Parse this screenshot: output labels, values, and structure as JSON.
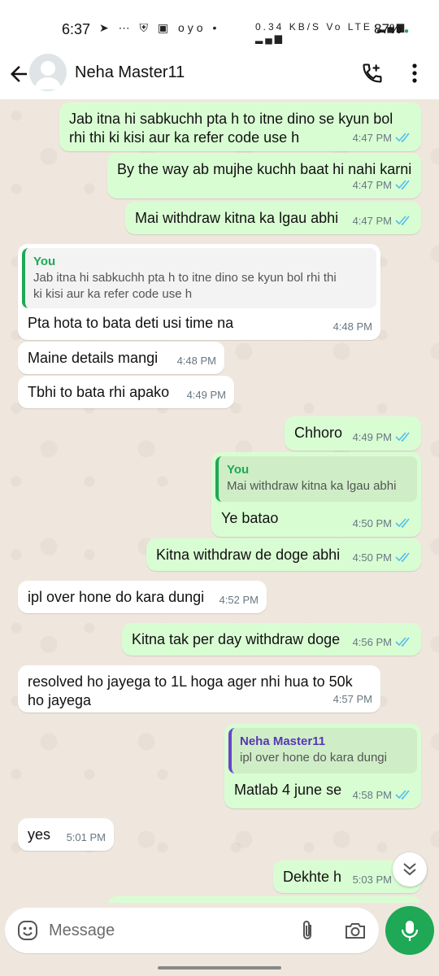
{
  "status_bar": {
    "time": "6:37",
    "left_icons": "➤ ⋯ ⛨ ▣ oyo •",
    "network_speed": "0.34 KB/S",
    "right_icons": "Vo LTE ▂▄▆ ▂▄▆",
    "battery": "87%"
  },
  "header": {
    "contact_name": "Neha Master11"
  },
  "messages": [
    {
      "dir": "out",
      "text_lines": [
        "Jab itna hi sabkuchh pta h to itne dino se kyun bol",
        "rhi thi ki kisi aur ka refer code use h"
      ],
      "time": "4:47 PM"
    },
    {
      "dir": "out",
      "text": "By the way ab mujhe kuchh baat hi nahi karni",
      "time": "4:47 PM"
    },
    {
      "dir": "out",
      "text": "Mai withdraw kitna ka lgau abhi",
      "time": "4:47 PM"
    },
    {
      "dir": "in",
      "quote_name": "You",
      "quote_lines": [
        "Jab itna hi sabkuchh pta h to itne dino se kyun bol rhi thi",
        "ki kisi aur ka refer code use h"
      ],
      "text": "Pta hota to bata deti usi time na",
      "time": "4:48 PM"
    },
    {
      "dir": "in",
      "text": "Maine details mangi",
      "time": "4:48 PM"
    },
    {
      "dir": "in",
      "text": "Tbhi to bata rhi apako",
      "time": "4:49 PM"
    },
    {
      "dir": "out",
      "text": "Chhoro",
      "time": "4:49 PM"
    },
    {
      "dir": "out",
      "quote_name": "You",
      "quote_text": "Mai withdraw kitna ka lgau abhi",
      "text": "Ye batao",
      "time": "4:50 PM"
    },
    {
      "dir": "out",
      "text": "Kitna withdraw de doge abhi",
      "time": "4:50 PM"
    },
    {
      "dir": "in",
      "text": "ipl over hone do kara dungi",
      "time": "4:52 PM"
    },
    {
      "dir": "out",
      "text": "Kitna tak per day withdraw doge",
      "time": "4:56 PM"
    },
    {
      "dir": "in",
      "text_lines": [
        "resolved ho jayega to 1L hoga ager nhi hua to 50k",
        "ho jayega"
      ],
      "time": "4:57 PM"
    },
    {
      "dir": "out",
      "quote_name": "Neha Master11",
      "quote_text": "ipl over hone do kara dungi",
      "text": "Matlab 4 june se",
      "time": "4:58 PM"
    },
    {
      "dir": "in",
      "text": "yes",
      "time": "5:01 PM"
    },
    {
      "dir": "out",
      "text": "Dekhte h",
      "time": "5:03 PM"
    }
  ],
  "composer": {
    "placeholder": "Message"
  },
  "colors": {
    "outgoing_bubble": "#d9fdd3",
    "incoming_bubble": "#ffffff",
    "chat_background": "#efe7dd",
    "accent_green": "#1fa855",
    "read_tick_blue": "#53bdeb"
  },
  "icons": [
    "back-arrow-icon",
    "avatar-icon",
    "add-call-icon",
    "more-vert-icon",
    "emoji-icon",
    "attach-icon",
    "camera-icon",
    "mic-icon",
    "scroll-down-icon",
    "read-ticks-icon"
  ]
}
